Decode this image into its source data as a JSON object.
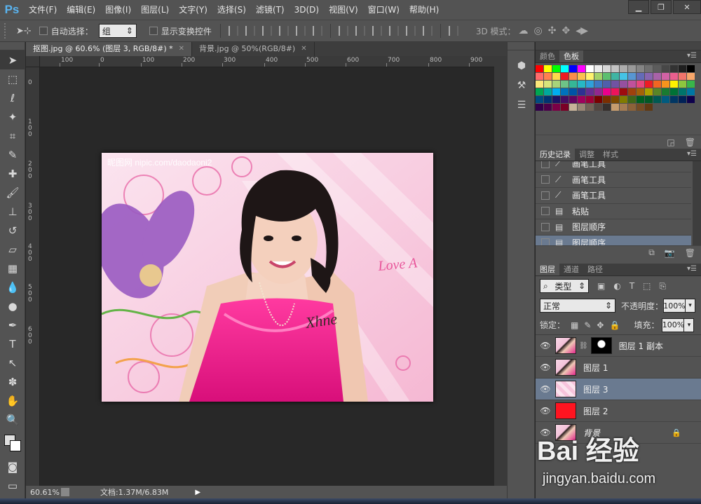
{
  "app": {
    "logo": "Ps",
    "window_buttons": [
      "▁",
      "❐",
      "✕"
    ]
  },
  "menu": [
    "文件(F)",
    "编辑(E)",
    "图像(I)",
    "图层(L)",
    "文字(Y)",
    "选择(S)",
    "滤镜(T)",
    "3D(D)",
    "视图(V)",
    "窗口(W)",
    "帮助(H)"
  ],
  "options": {
    "auto_select_label": "自动选择：",
    "auto_select_value": "组",
    "show_transform_label": "显示变换控件",
    "mode_label": "3D 模式："
  },
  "doc_tabs": [
    {
      "label": "抠图.jpg @ 60.6% (图层 3, RGB/8#) *",
      "active": true
    },
    {
      "label": "背景.jpg @ 50%(RGB/8#)",
      "active": false
    }
  ],
  "ruler": {
    "h_ticks": [
      "100",
      "0",
      "100",
      "200",
      "300",
      "400",
      "500",
      "600",
      "700",
      "800",
      "900"
    ],
    "v_ticks": [
      "0",
      "1 0 0",
      "2 0 0",
      "3 0 0",
      "4 0 0",
      "5 0 0",
      "6 0 0"
    ]
  },
  "image": {
    "watermark": "昵图网 nipic.com/daodaoni2",
    "slogan": "Love A",
    "signature": "Xhne"
  },
  "status": {
    "zoom": "60.61%",
    "doc": "文档:1.37M/6.83M"
  },
  "swatch_panel": {
    "tabs": [
      "颜色",
      "色板"
    ],
    "active": 1,
    "colors": [
      "#ff0000",
      "#ffff00",
      "#00ff00",
      "#00ffff",
      "#0000ff",
      "#ff00ff",
      "#ffffff",
      "#ebebeb",
      "#d6d6d6",
      "#c2c2c2",
      "#adadad",
      "#999999",
      "#858585",
      "#707070",
      "#5c5c5c",
      "#474747",
      "#333333",
      "#1f1f1f",
      "#000000",
      "#ff6b6b",
      "#ff7f50",
      "#ffd84a",
      "#eb1c24",
      "#fa8c4c",
      "#fbc050",
      "#fff36f",
      "#a3d26a",
      "#5cbf6f",
      "#3fb5a3",
      "#45c3e6",
      "#5896d3",
      "#646bb7",
      "#8865af",
      "#a862a8",
      "#d162a5",
      "#e95f8e",
      "#f1746b",
      "#f7a66a",
      "#fce77a",
      "#d7e47b",
      "#a7d37a",
      "#6ec387",
      "#35b797",
      "#26b8c5",
      "#2fa0db",
      "#3e78c3",
      "#4f5fab",
      "#7153a2",
      "#96509f",
      "#c0519c",
      "#e6467e",
      "#ed1c24",
      "#f26522",
      "#f7941d",
      "#fff200",
      "#8dc63f",
      "#39b54a",
      "#00a651",
      "#00a99d",
      "#00aeef",
      "#0072bc",
      "#0054a6",
      "#2e3192",
      "#662d91",
      "#92278f",
      "#ec008c",
      "#ed145b",
      "#9e0b0f",
      "#a0410d",
      "#a36209",
      "#aba000",
      "#598527",
      "#197b30",
      "#007236",
      "#00746b",
      "#0076a3",
      "#004b80",
      "#003471",
      "#1b1464",
      "#440e62",
      "#630460",
      "#9e005d",
      "#9e0039",
      "#790000",
      "#7b2e00",
      "#7d4900",
      "#827b00",
      "#406618",
      "#005e20",
      "#005826",
      "#005952",
      "#005b7f",
      "#003663",
      "#002157",
      "#0d004c",
      "#32004b",
      "#4b0049",
      "#7b0046",
      "#7a0026",
      "#c7b299",
      "#998675",
      "#736357",
      "#534741",
      "#37302d",
      "#c69c6e",
      "#a67c52",
      "#8c6239",
      "#754c24",
      "#603913"
    ]
  },
  "history": {
    "tabs": [
      "历史记录",
      "调整",
      "样式"
    ],
    "active": 0,
    "items": [
      {
        "label": "画笔工具",
        "icon": "brush-icon"
      },
      {
        "label": "画笔工具",
        "icon": "brush-icon"
      },
      {
        "label": "画笔工具",
        "icon": "brush-icon"
      },
      {
        "label": "粘贴",
        "icon": "doc-icon"
      },
      {
        "label": "图层顺序",
        "icon": "doc-icon"
      },
      {
        "label": "图层顺序",
        "icon": "doc-icon",
        "selected": true
      }
    ]
  },
  "layers": {
    "tabs": [
      "图层",
      "通道",
      "路径"
    ],
    "active": 0,
    "filter": "类型",
    "blend": "正常",
    "opacity_label": "不透明度：",
    "opacity": "100%",
    "lock_label": "锁定：",
    "fill_label": "填充：",
    "fill": "100%",
    "items": [
      {
        "name": "图层 1 副本",
        "thumb": "photo",
        "mask": true
      },
      {
        "name": "图层 1",
        "thumb": "photo"
      },
      {
        "name": "图层 3",
        "thumb": "pink",
        "selected": true
      },
      {
        "name": "图层 2",
        "thumb": "red"
      },
      {
        "name": "背景",
        "thumb": "photo",
        "locked": true
      }
    ]
  },
  "watermark": {
    "brand": "Bai 经验",
    "url": "jingyan.baidu.com"
  }
}
